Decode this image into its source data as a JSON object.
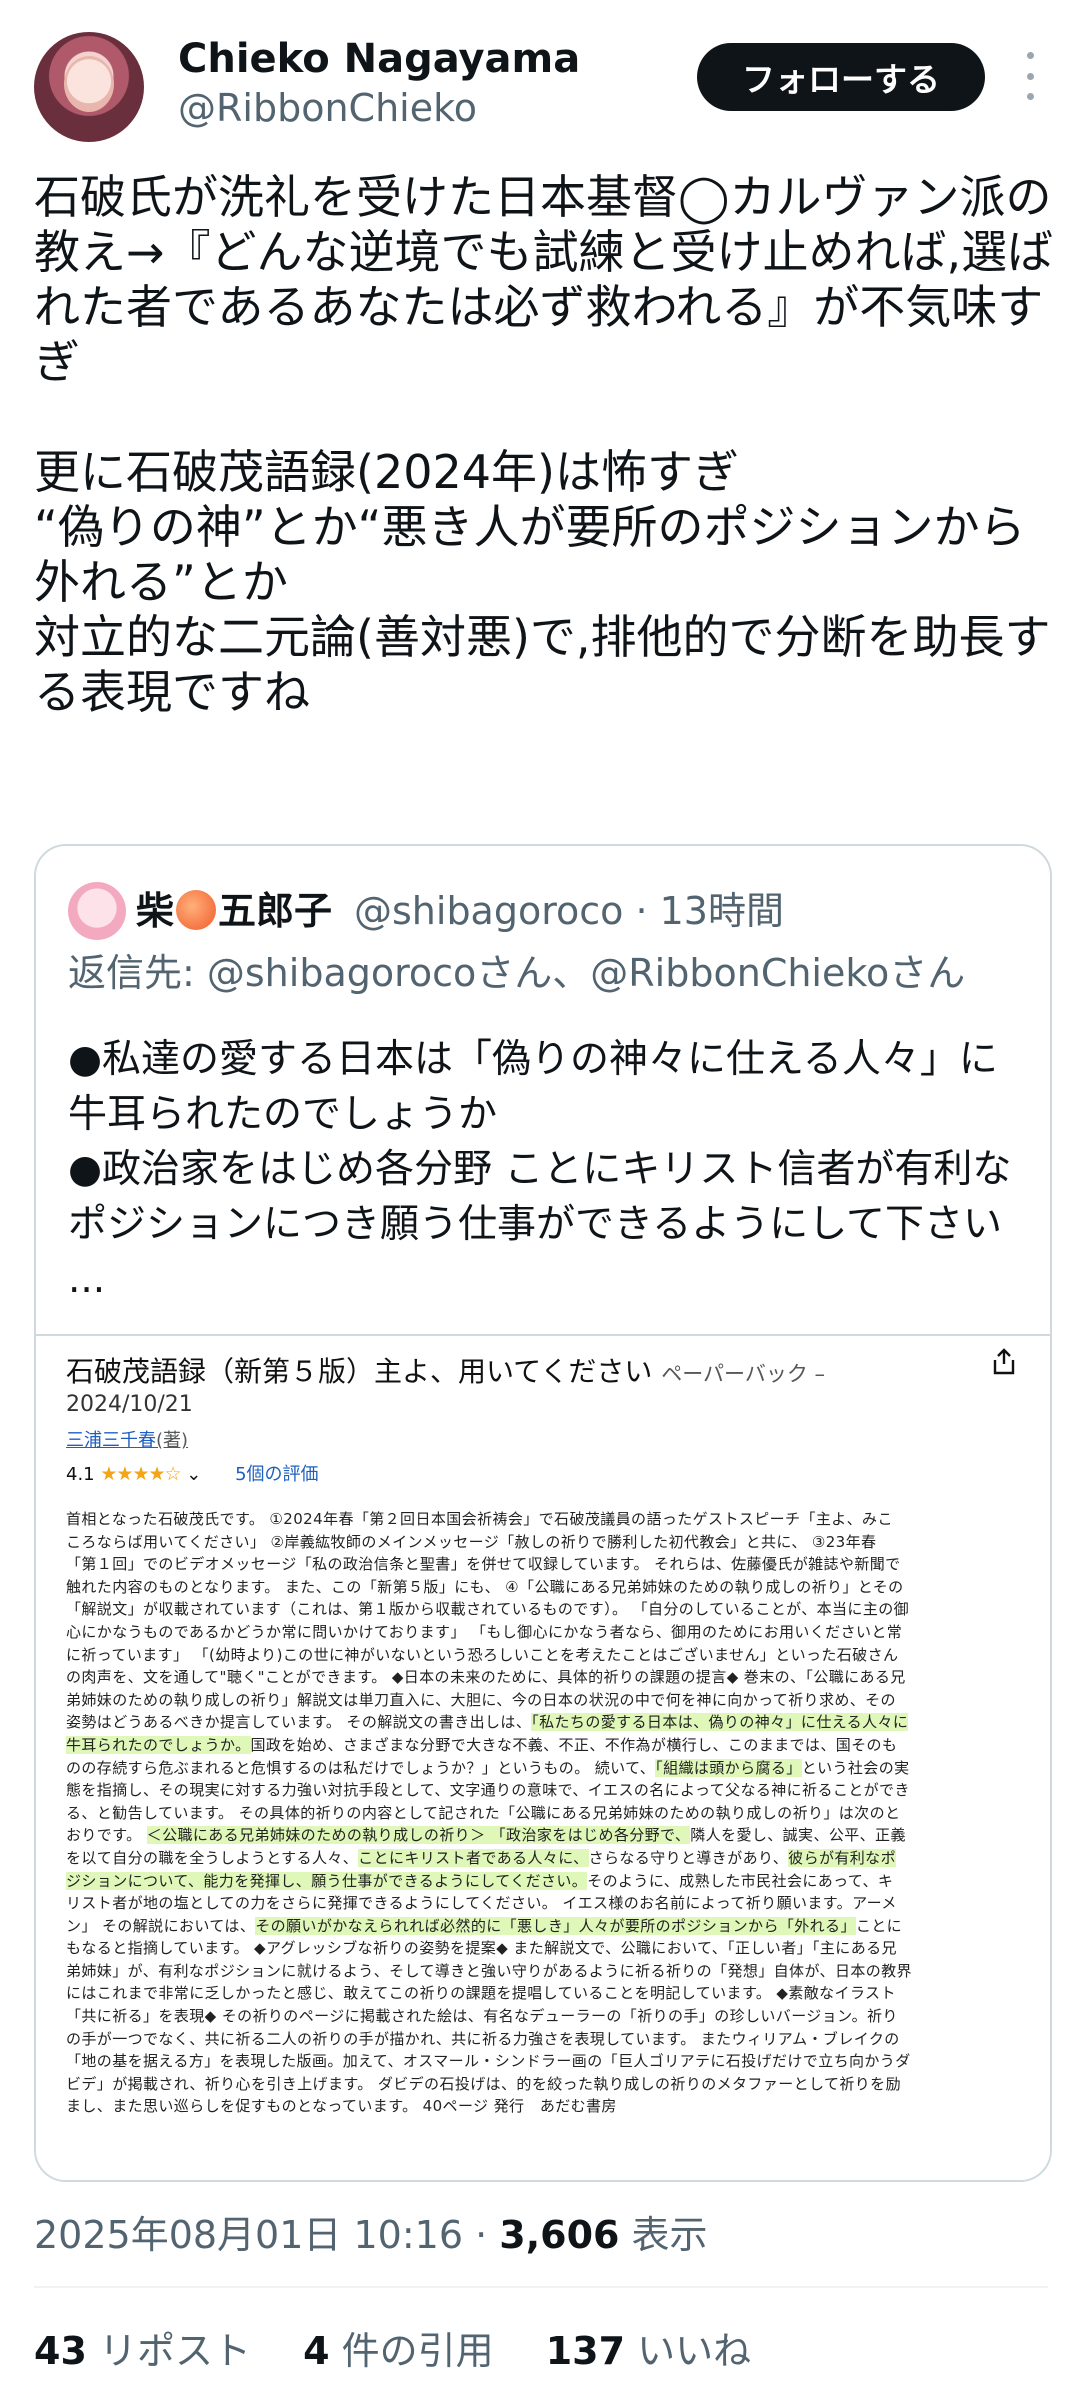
{
  "author": {
    "display_name": "Chieko Nagayama",
    "handle": "@RibbonChieko",
    "follow_label": "フォローする"
  },
  "tweet": {
    "paragraph1": "石破氏が洗礼を受けた日本基督◯カルヴァン派の教え→『どんな逆境でも試練と受け止めれば,選ばれた者であるあなたは必ず救われる』が不気味すぎ",
    "line2a": "更に石破茂語録(2024年)は怖すぎ",
    "line2b": "“偽りの神”とか“悪き人が要所のポジションから外れる”とか",
    "line2c": "対立的な二元論(善対悪)で,排他的で分断を助長する表現ですね"
  },
  "quote": {
    "name_part1": "柴",
    "name_part2": "五郎子",
    "name_emoji": "peach-icon",
    "handle_time": "@shibagoroco · 13時間",
    "reply_to": "返信先: @shibagorocoさん、@RibbonChiekoさん",
    "text1": "●私達の愛する日本は「偽りの神々に仕える人々」に牛耳られたのでしょうか",
    "text2": "●政治家をはじめ各分野 ことにキリスト信者が有利なポジションにつき願う仕事ができるようにして下さい ..."
  },
  "book": {
    "title": "石破茂語録（新第５版）主よ、用いてください",
    "format": "ペーパーバック –",
    "date": "2024/10/21",
    "author": "三浦三千春",
    "author_role": "(著)",
    "rating_value": "4.1",
    "rating_stars": "★★★★☆",
    "rating_count": "5個の評価",
    "desc_lines": [
      "首相となった石破茂氏です。 ①2024年春「第２回日本国会祈祷会」で石破茂議員の語ったゲストスピーチ「主よ、みこ",
      "ころならば用いてください」 ②岸義紘牧師のメインメッセージ「赦しの祈りで勝利した初代教会」と共に、 ③23年春",
      "「第１回」でのビデオメッセージ「私の政治信条と聖書」を併せて収録しています。 それらは、佐藤優氏が雑誌や新聞で",
      "触れた内容のものとなります。 また、この「新第５版」にも、 ④「公職にある兄弟姉妹のための執り成しの祈り」とその",
      "「解説文」が収載されています（これは、第１版から収載されているものです）。 「自分のしていることが、本当に主の御",
      "心にかなうものであるかどうか常に問いかけております」 「もし御心にかなう者なら、御用のためにお用いくださいと常",
      "に祈っています」 「(幼時より)この世に神がいないという恐ろしいことを考えたことはございません」といった石破さん",
      "の肉声を、文を通して\"聴く\"ことができます。 ◆日本の未来のために、具体的祈りの課題の提言◆ 巻末の、「公職にある兄",
      "弟姉妹のための執り成しの祈り」解説文は単刀直入に、大胆に、今の日本の状況の中で何を神に向かって祈り求め、その",
      "姿勢はどうあるべきか提言しています。 その解説文の書き出しは、"
    ],
    "desc_hl1": "「私たちの愛する日本は、偽りの神々」に仕える人々に",
    "desc_line11_hl": "牛耳られたのでしょうか。",
    "desc_line11_rest": "国政を始め、さまざまな分野で大きな不義、不正、不作為が横行し、このままでは、国そのも",
    "desc_lines_b": [
      "のの存続すら危ぶまれると危惧するのは私だけでしょうか？」というもの。 続いて、",
      "態を指摘し、その現実に対する力強い対抗手段として、文字通りの意味で、イエスの名によって父なる神に祈ることができ",
      "る、と勧告しています。 その具体的祈りの内容として記された「公職にある兄弟姉妹のための執り成しの祈り」は次のと",
      "おりです。 "
    ],
    "desc_hl2": "「組織は頭から腐る」",
    "desc_line12_rest": "という社会の実",
    "desc_hl3": "＜公職にある兄弟姉妹のための執り成しの祈り＞ 「政治家をはじめ各分野で、",
    "desc_line15_rest": "隣人を愛し、誠実、公平、正義",
    "desc_line16_a": "を以て自分の職を全うしようとする人々、",
    "desc_hl4": "ことにキリスト者である人々に、",
    "desc_line16_b": "さらなる守りと導きがあり、",
    "desc_hl5": "彼らが有利なポ",
    "desc_hl6": "ジションについて、能力を発揮し、願う仕事ができるようにしてください。",
    "desc_line17_rest": "そのように、成熟した市民社会にあって、キ",
    "desc_lines_c": [
      "リスト者が地の塩としての力をさらに発揮できるようにしてください。 イエス様のお名前によって祈り願います。アーメ"
    ],
    "desc_line19_a": "ン」 その解説においては、",
    "desc_hl7": "その願いがかなえられれば必然的に「悪しき」人々が要所のポジションから「外れる」",
    "desc_line19_b": "ことに",
    "desc_lines_d": [
      "もなると指摘しています。 ◆アグレッシブな祈りの姿勢を提案◆ また解説文で、公職において、「正しい者」「主にある兄",
      "弟姉妹」が、有利なポジションに就けるよう、そして導きと強い守りがあるように祈る祈りの「発想」自体が、日本の教界",
      "にはこれまで非常に乏しかったと感じ、敢えてこの祈りの課題を提唱していることを明記しています。 ◆素敵なイラスト",
      "「共に祈る」を表現◆ その祈りのページに掲載された絵は、有名なデューラーの「祈りの手」の珍しいバージョン。祈り",
      "の手が一つでなく、共に祈る二人の祈りの手が描かれ、共に祈る力強さを表現しています。 またウィリアム・ブレイクの",
      "「地の基を据える方」を表現した版画。加えて、オスマール・シンドラー画の「巨人ゴリアテに石投げだけで立ち向かうダ",
      "ビデ」が掲載され、祈り心を引き上げます。 ダビデの石投げは、的を絞った執り成しの祈りのメタファーとして祈りを励",
      "まし、また思い巡らしを促すものとなっています。 40ページ 発行　あだむ書房"
    ]
  },
  "meta": {
    "timestamp": "2025年08月01日 10:16 · ",
    "views_count": "3,606",
    "views_label": " 表示"
  },
  "stats": {
    "reposts_count": "43",
    "reposts_label": " リポスト",
    "quotes_count": "4",
    "quotes_label": " 件の引用",
    "likes_count": "137",
    "likes_label": " いいね"
  }
}
